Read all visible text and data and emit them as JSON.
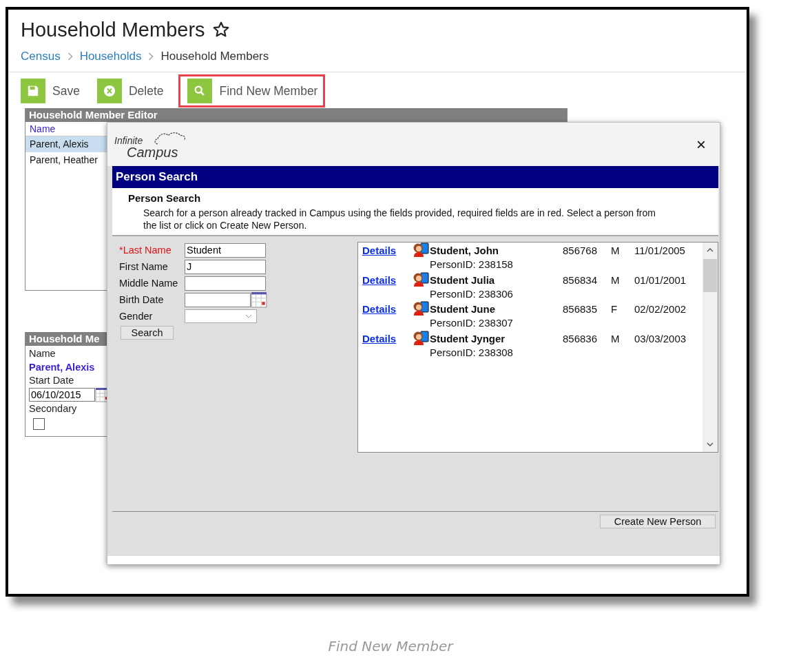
{
  "page": {
    "title": "Household Members",
    "favorite": false
  },
  "breadcrumbs": [
    {
      "label": "Census",
      "kind": "link"
    },
    {
      "label": "Households",
      "kind": "link"
    },
    {
      "label": "Household Members",
      "kind": "current"
    }
  ],
  "toolbar": [
    {
      "label": "Save",
      "kind": "save",
      "highlighted": false
    },
    {
      "label": "Delete",
      "kind": "delete",
      "highlighted": false
    },
    {
      "label": "Find New Member",
      "kind": "find",
      "highlighted": true
    }
  ],
  "editor": {
    "title": "Household Member Editor",
    "column": "Name",
    "rows": [
      {
        "name": "Parent, Alexis",
        "selected": true
      },
      {
        "name": "Parent, Heather",
        "selected": false
      }
    ]
  },
  "detail": {
    "title": "Household Me",
    "name_label": "Name",
    "name": "Parent, Alexis",
    "start_date_label": "Start Date",
    "start_date": "06/10/2015",
    "secondary_label": "Secondary",
    "secondary": false
  },
  "dialog": {
    "logo_top": "Infinite",
    "logo_bottom": "Campus",
    "close": "×",
    "header": "Person Search",
    "section_title": "Person Search",
    "instructions": "Search for a person already tracked in Campus using the fields provided, required fields are in red. Select a person from the list or click on Create New Person.",
    "fields": [
      {
        "label": "*Last Name",
        "required": true,
        "kind": "text",
        "value": "Student"
      },
      {
        "label": "First Name",
        "required": false,
        "kind": "text",
        "value": "J"
      },
      {
        "label": "Middle Name",
        "required": false,
        "kind": "text"
      },
      {
        "label": "Birth Date",
        "required": false,
        "kind": "date"
      },
      {
        "label": "Gender",
        "required": false,
        "kind": "select"
      }
    ],
    "search_button": "Search",
    "results": [
      {
        "link": "Details",
        "name": "Student, John",
        "person_id": "PersonID: 238158",
        "number": "856768",
        "gender": "M",
        "birth_date": "11/01/2005"
      },
      {
        "link": "Details",
        "name": "Student Julia",
        "person_id": "PersonID: 238306",
        "number": "856834",
        "gender": "M",
        "birth_date": "01/01/2001"
      },
      {
        "link": "Details",
        "name": "Student June",
        "person_id": "PersonID: 238307",
        "number": "856835",
        "gender": "F",
        "birth_date": "02/02/2002"
      },
      {
        "link": "Details",
        "name": "Student Jynger",
        "person_id": "PersonID: 238308",
        "number": "856836",
        "gender": "M",
        "birth_date": "03/03/2003"
      }
    ],
    "create_button": "Create New Person"
  },
  "caption": "Find New Member"
}
